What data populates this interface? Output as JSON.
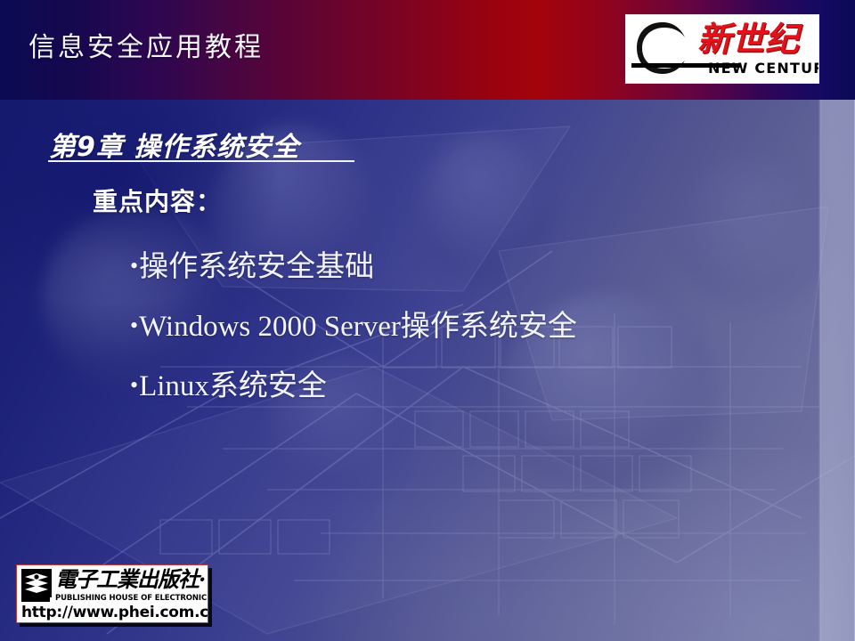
{
  "slide": {
    "header": {
      "title": "信息安全应用教程",
      "gradient_start": "#0a0b52",
      "gradient_mid": "#a4030c",
      "gradient_end": "#0b0a56"
    },
    "brand_logo": {
      "emblem_text": "新世纪",
      "chinese_name": "新世纪",
      "english_name": "NEW CENTURY",
      "accent_color": "#e2121a"
    },
    "body": {
      "chapter_title": "第9章 操作系统安全",
      "subheading": "重点内容：",
      "bullet_marker": "•",
      "bullets": [
        "操作系统安全基础",
        "Windows 2000 Server操作系统安全",
        "Linux系统安全"
      ]
    },
    "publisher_logo": {
      "chinese_name": "電子工業出版社·",
      "english_name": "PUBLISHING HOUSE OF ELECTRONICS INDUSTRY",
      "url": "http://www.phei.com.cn"
    },
    "theme": {
      "body_background_dark": "#161a6e",
      "body_background_light": "#7276a3",
      "text_color": "#f2f3fa"
    }
  }
}
